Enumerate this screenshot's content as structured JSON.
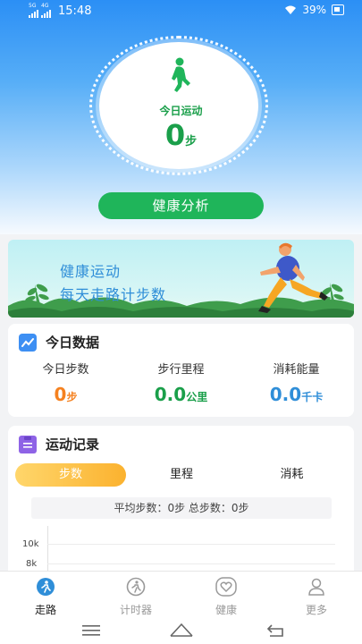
{
  "status_bar": {
    "network_1": "5G",
    "network_2": "4G",
    "time": "15:48",
    "battery": "39%"
  },
  "hero": {
    "today_label": "今日运动",
    "steps_value": "0",
    "steps_unit": "步",
    "analysis_button": "健康分析",
    "accent": "#1a9f4a"
  },
  "banner": {
    "title": "健康运动",
    "subtitle": "每天走路计步数"
  },
  "today_data": {
    "title": "今日数据",
    "metrics": [
      {
        "label": "今日步数",
        "value": "0",
        "unit": "步",
        "color": "#f5811f"
      },
      {
        "label": "步行里程",
        "value": "0.0",
        "unit": "公里",
        "color": "#1a9f4a"
      },
      {
        "label": "消耗能量",
        "value": "0.0",
        "unit": "千卡",
        "color": "#2f8ed8"
      }
    ]
  },
  "records": {
    "title": "运动记录",
    "tabs": [
      {
        "label": "步数",
        "active": true
      },
      {
        "label": "里程",
        "active": false
      },
      {
        "label": "消耗",
        "active": false
      }
    ],
    "summary": "平均步数：0步 总步数：0步",
    "y_ticks": [
      "10k",
      "8k"
    ]
  },
  "bottom_nav": [
    {
      "label": "走路",
      "icon": "walk-icon",
      "active": true
    },
    {
      "label": "计时器",
      "icon": "timer-icon",
      "active": false
    },
    {
      "label": "健康",
      "icon": "heart-icon",
      "active": false
    },
    {
      "label": "更多",
      "icon": "user-icon",
      "active": false
    }
  ]
}
